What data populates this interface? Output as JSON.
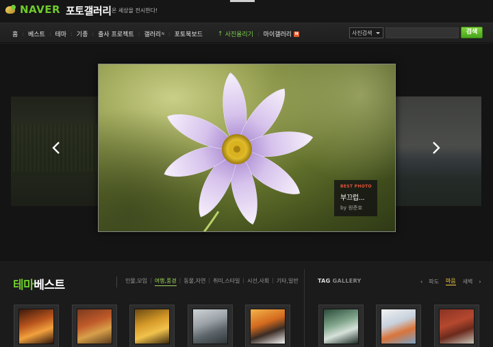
{
  "header": {
    "logo_text": "NAVER",
    "site_title": "포토갤러리",
    "slogan": "온 세상을 전시한다!"
  },
  "nav": {
    "items": [
      {
        "label": "홈"
      },
      {
        "label": "베스트"
      },
      {
        "label": "테마"
      },
      {
        "label": "기종"
      },
      {
        "label": "출사 프로젝트"
      },
      {
        "label": "갤러리",
        "sup": "N"
      },
      {
        "label": "포토북보드"
      }
    ],
    "upload_label": "사진올리기",
    "my_gallery_label": "마이갤러리",
    "my_gallery_badge": "N"
  },
  "search": {
    "scope_selected": "사진검색",
    "query": "",
    "button_label": "검색"
  },
  "hero": {
    "best_label": "BEST PHOTO",
    "photo_title": "부끄럽...",
    "by_prefix": "by",
    "author": "원준호",
    "photo_subject": "purple cosmos flower"
  },
  "theme_best": {
    "title_green": "테마",
    "title_white": "베스트",
    "tabs": [
      {
        "label": "인물,모임",
        "active": false
      },
      {
        "label": "여행,풍경",
        "active": true
      },
      {
        "label": "동물,자연",
        "active": false
      },
      {
        "label": "취미,스타일",
        "active": false
      },
      {
        "label": "시선,사회",
        "active": false
      },
      {
        "label": "기타,일반",
        "active": false
      }
    ]
  },
  "tag_gallery": {
    "title_bright": "TAG",
    "title_dim": "GALLERY",
    "tags": [
      {
        "label": "파도",
        "active": false
      },
      {
        "label": "마음",
        "active": true
      },
      {
        "label": "새벽",
        "active": false
      }
    ]
  },
  "thumbnails": [
    {
      "subject": "sunset over water",
      "colors": [
        "#3b1a0c",
        "#b8541d",
        "#f2a13e",
        "#2a120a"
      ]
    },
    {
      "subject": "autumn trees",
      "colors": [
        "#7b3a1e",
        "#c05a2a",
        "#d8a04a",
        "#5a3a1c"
      ]
    },
    {
      "subject": "yellow autumn leaves",
      "colors": [
        "#6b4a12",
        "#d69a28",
        "#f1c24c",
        "#3c2a0e"
      ]
    },
    {
      "subject": "boat on misty lake",
      "colors": [
        "#cfd3d6",
        "#9aa1a6",
        "#5d666b",
        "#2f3639"
      ]
    },
    {
      "subject": "lake sunset",
      "colors": [
        "#f4b44a",
        "#d46a1e",
        "#3a2c24",
        "#f6f6f6"
      ]
    },
    {
      "subject": "waves close-up",
      "colors": [
        "#2b4a3a",
        "#7fa48a",
        "#d6e2da",
        "#1c2b24"
      ]
    },
    {
      "subject": "colored pencils",
      "colors": [
        "#f2f2f2",
        "#c6d0dc",
        "#d9743a",
        "#7aa3c7"
      ]
    },
    {
      "subject": "brick wall",
      "colors": [
        "#8a3324",
        "#b5482f",
        "#6b2a1c",
        "#c8c4b8"
      ]
    }
  ]
}
